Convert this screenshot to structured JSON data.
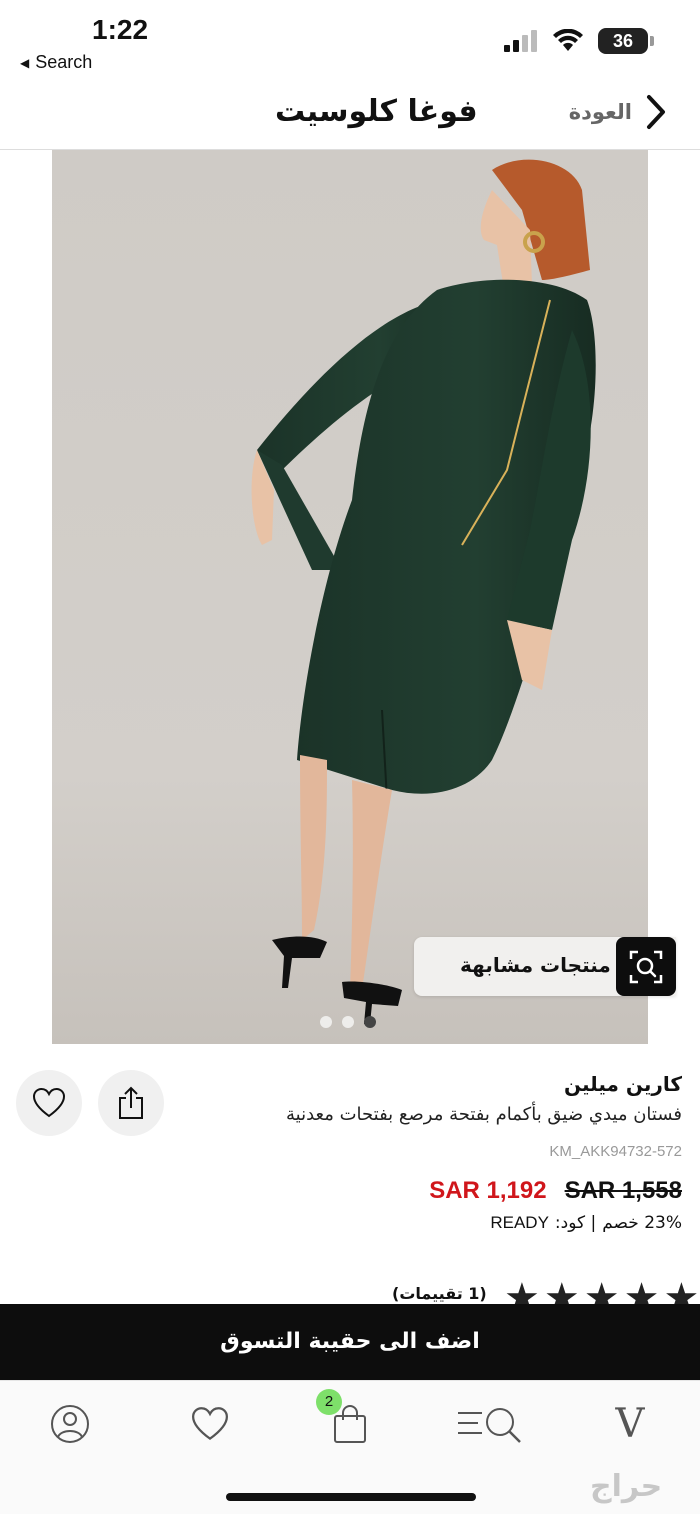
{
  "status_bar": {
    "time": "1:22",
    "back_app": "Search",
    "battery": "36"
  },
  "header": {
    "title": "فوغا كلوسيت",
    "back_label": "العودة"
  },
  "product": {
    "similar_label": "منتجات مشابهة",
    "brand": "كارين ميلين",
    "description": "فستان ميدي ضيق بأكمام بفتحة مرصع بفتحات معدنية",
    "sku": "KM_AKK94732-572",
    "price_old": "SAR 1,558",
    "price_new": "SAR 1,192",
    "discount": "23% خصم",
    "code_label": "| كود:",
    "code_value": "READY",
    "ratings_label": "(1 تقييمات)",
    "image_count": 3,
    "active_image": 3,
    "rating_stars": 5
  },
  "actions": {
    "add_to_bag": "اضف الى حقيبة التسوق"
  },
  "tab_bar": {
    "bag_count": "2",
    "watermark": "حراج"
  },
  "colors": {
    "price_sale": "#d0161b",
    "dress": "#1f3a2e",
    "badge": "#7ee06a"
  }
}
